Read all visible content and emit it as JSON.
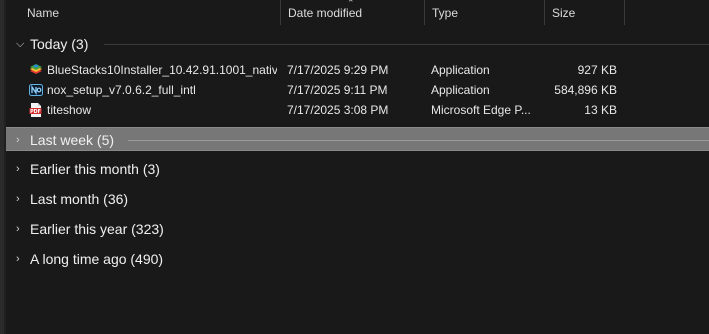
{
  "columns": {
    "name": "Name",
    "date_modified": "Date modified",
    "type": "Type",
    "size": "Size"
  },
  "sort": {
    "column": "date_modified",
    "direction": "descending",
    "icon": "chevron-up-icon"
  },
  "groups": {
    "today": {
      "label": "Today (3)",
      "expanded": true
    },
    "last_week": {
      "label": "Last week (5)",
      "expanded": false,
      "selected": true
    },
    "earlier_this_month": {
      "label": "Earlier this month (3)",
      "expanded": false
    },
    "last_month": {
      "label": "Last month (36)",
      "expanded": false
    },
    "earlier_this_year": {
      "label": "Earlier this year (323)",
      "expanded": false
    },
    "a_long_time_ago": {
      "label": "A long time ago (490)",
      "expanded": false
    }
  },
  "files": [
    {
      "name": "BlueStacks10Installer_10.42.91.1001_nativ...",
      "date": "7/17/2025 9:29 PM",
      "type": "Application",
      "size": "927 KB",
      "icon": "bluestacks-app-icon"
    },
    {
      "name": "nox_setup_v7.0.6.2_full_intl",
      "date": "7/17/2025 9:11 PM",
      "type": "Application",
      "size": "584,896 KB",
      "icon": "nox-app-icon"
    },
    {
      "name": "titeshow",
      "date": "7/17/2025 3:08 PM",
      "type": "Microsoft Edge P...",
      "size": "13 KB",
      "icon": "pdf-file-icon"
    }
  ],
  "colors": {
    "background": "#191919",
    "selected_group": "#777777",
    "separator": "#3a3a3a",
    "pdf_red": "#d32f2f"
  }
}
